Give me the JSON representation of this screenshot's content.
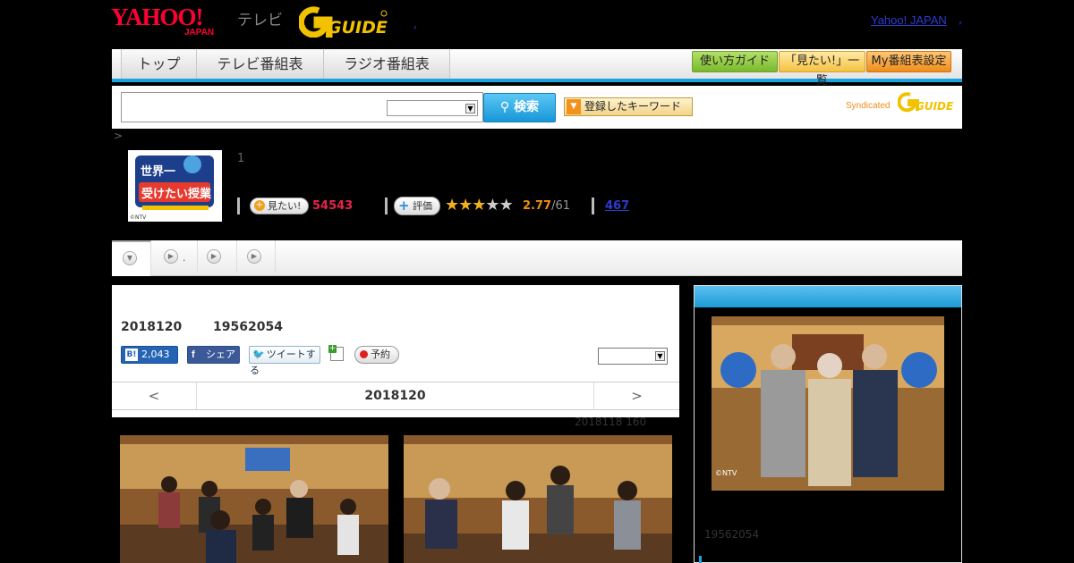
{
  "header": {
    "yahoo_logo": "YAHOO!",
    "japan_logo": "JAPAN",
    "tv_label": "テレビ",
    "gguide_logo": "G GUIDE",
    "yahoo_japan_link": "Yahoo! JAPAN"
  },
  "nav": {
    "tabs": [
      "トップ",
      "テレビ番組表",
      "ラジオ番組表"
    ],
    "guide_buttons": [
      "使い方ガイド",
      "「見たい!」一覧",
      "My番組表設定"
    ]
  },
  "search": {
    "placeholder": "",
    "button_label": "検索",
    "keyword_button": "登録したキーワード",
    "syndicated": "Syndicated"
  },
  "breadcrumb": ">",
  "program": {
    "thumbnail_text": "世界一受けたい授業",
    "thumbnail_credit": "©NTV",
    "episode_number": "1",
    "mitai_label": "見たい!",
    "mitai_count": "54543",
    "hyoka_label": "評価",
    "rating_value": 2.77,
    "rating_display": "2.77",
    "rating_total": "/61",
    "review_count": "467"
  },
  "subtabs": [
    ".",
    "",
    "",
    ""
  ],
  "episode": {
    "date": "2018120",
    "program_id": "19562054",
    "hatena_count": "2,043",
    "facebook_label": "シェア",
    "tweet_label": "ツイートする",
    "yoyaku_label": "予約",
    "pager_prev": "<",
    "pager_current": "2018120",
    "pager_next": ">",
    "note": "2018118  160"
  },
  "side": {
    "photo_credit": "©NTV",
    "program_id": "19562054"
  },
  "colors": {
    "accent_blue": "#1aa3e0",
    "yahoo_red": "#ff0033",
    "mitai_pink": "#e8244a",
    "rating_orange": "#f08c1a",
    "link_blue": "#2e3bd0"
  }
}
